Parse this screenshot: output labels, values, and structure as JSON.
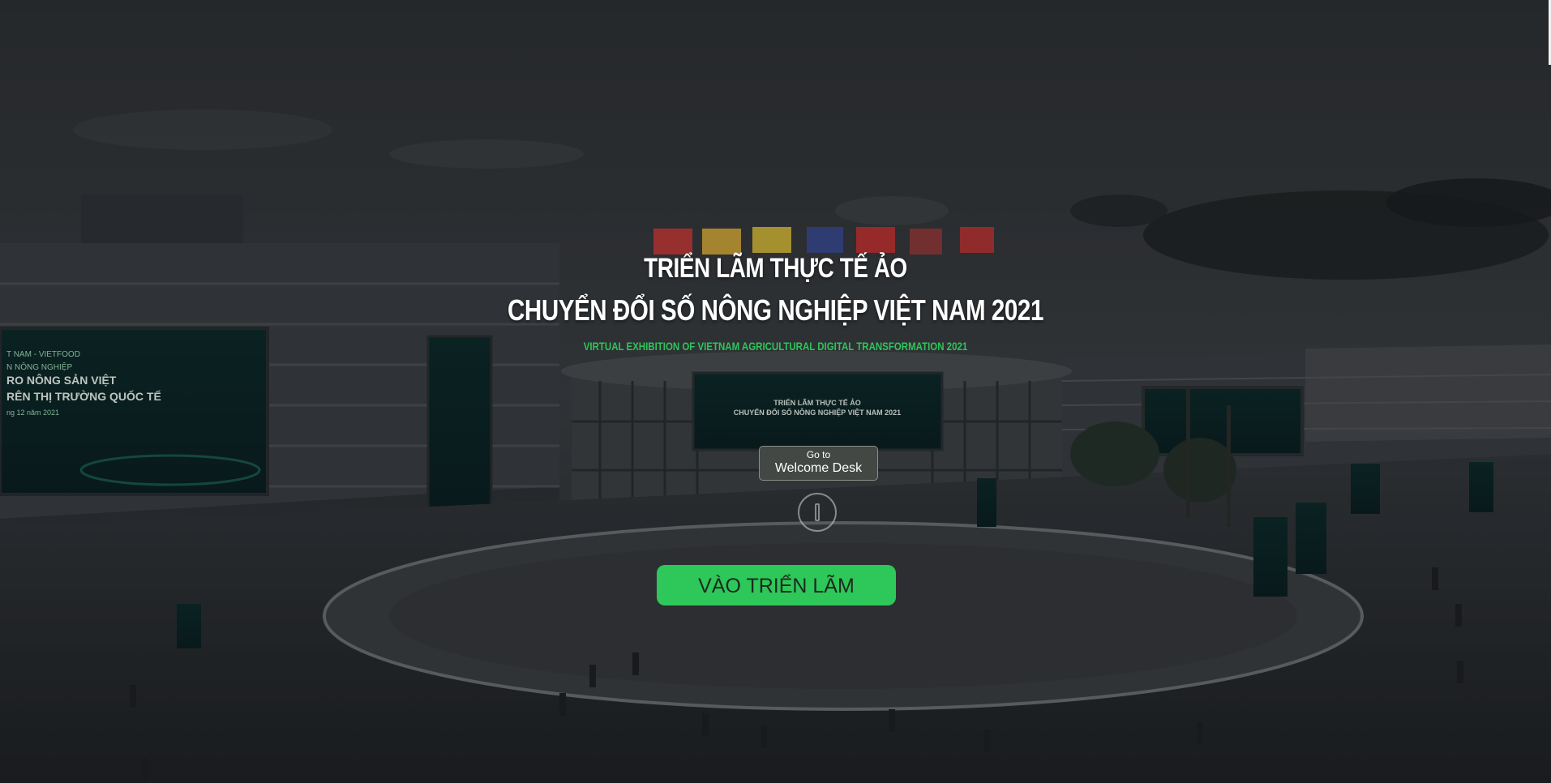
{
  "exhibition": {
    "title_line1": "TRIỂN LÃM THỰC TẾ ẢO",
    "title_line2": "CHUYỂN ĐỔI SỐ NÔNG NGHIỆP VIỆT NAM 2021",
    "subtitle": "VIRTUAL EXHIBITION OF VIETNAM AGRICULTURAL DIGITAL TRANSFORMATION 2021"
  },
  "welcome_desk": {
    "line1": "Go to",
    "line2": "Welcome Desk"
  },
  "enter_button": {
    "label": "VÀO TRIỂN LÃM"
  },
  "scene": {
    "billboard_left": {
      "line1": "T NAM - VIETFOOD",
      "line2": "N NÔNG NGHIỆP",
      "line3": "RO NÔNG SẢN VIỆT",
      "line4": "RÊN THỊ TRƯỜNG QUỐC TẾ",
      "line5": "ng 12 năm 2021"
    },
    "billboard_center": {
      "line1": "TRIỂN LÃM THỰC TẾ ẢO",
      "line2": "CHUYỂN ĐỔI SỐ NÔNG NGHIỆP VIỆT NAM 2021"
    }
  },
  "colors": {
    "accent": "#2ec75a",
    "subtitle": "#2fc55a",
    "background": "#1c2024"
  },
  "icons": {
    "play": "play-circle-icon",
    "flags": "flag-icon"
  }
}
